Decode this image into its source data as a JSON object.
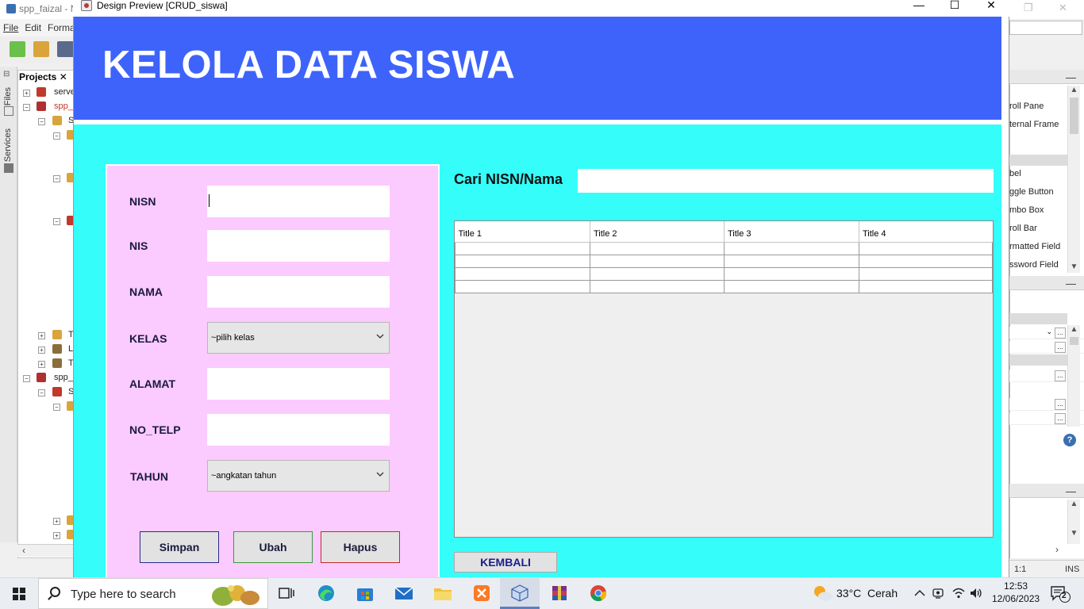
{
  "ide": {
    "window_title": "spp_faizal - N",
    "menus": [
      "File",
      "Edit",
      "Forma"
    ],
    "side_tabs": [
      "Files",
      "Services"
    ],
    "projects_tab": "Projects",
    "tree": [
      "serve",
      "spp_",
      "S",
      "T",
      "L",
      "T",
      "spp_",
      "S"
    ],
    "palette_items": [
      "roll Pane",
      "ternal Frame",
      "bel",
      "ggle Button",
      "mbo Box",
      "roll Bar",
      "rmatted Field",
      "ssword Field"
    ],
    "status": {
      "position": "1:1",
      "mode": "INS"
    }
  },
  "preview": {
    "window_title": "Design Preview [CRUD_siswa]",
    "header_title": "KELOLA DATA SISWA",
    "form": {
      "nisn_label": "NISN",
      "nis_label": "NIS",
      "nama_label": "NAMA",
      "kelas_label": "KELAS",
      "kelas_selected": "~pilih kelas",
      "alamat_label": "ALAMAT",
      "no_telp_label": "NO_TELP",
      "tahun_label": "TAHUN",
      "tahun_selected": "~angkatan tahun"
    },
    "buttons": {
      "simpan": "Simpan",
      "ubah": "Ubah",
      "hapus": "Hapus",
      "kembali": "KEMBALI"
    },
    "search_label": "Cari NISN/Nama",
    "table": {
      "columns": [
        "Title 1",
        "Title 2",
        "Title 3",
        "Title 4"
      ],
      "rows": [
        [
          "",
          "",
          "",
          ""
        ],
        [
          "",
          "",
          "",
          ""
        ],
        [
          "",
          "",
          "",
          ""
        ],
        [
          "",
          "",
          "",
          ""
        ]
      ]
    },
    "colors": {
      "header": "#3e63fb",
      "background": "#35fefa",
      "form_panel": "#fbcafe",
      "simpan_border": "#2b2b8a",
      "ubah_border": "#3a9a3a",
      "hapus_border": "#c22a2a"
    }
  },
  "taskbar": {
    "search_placeholder": "Type here to search",
    "weather_temp": "33°C",
    "weather_text": "Cerah",
    "time": "12:53",
    "date": "12/06/2023",
    "notification_count": "2",
    "apps": [
      "task-view-icon",
      "edge-icon",
      "store-icon",
      "mail-icon",
      "explorer-icon",
      "xampp-icon",
      "java-preview-icon",
      "winrar-icon",
      "chrome-icon"
    ]
  }
}
